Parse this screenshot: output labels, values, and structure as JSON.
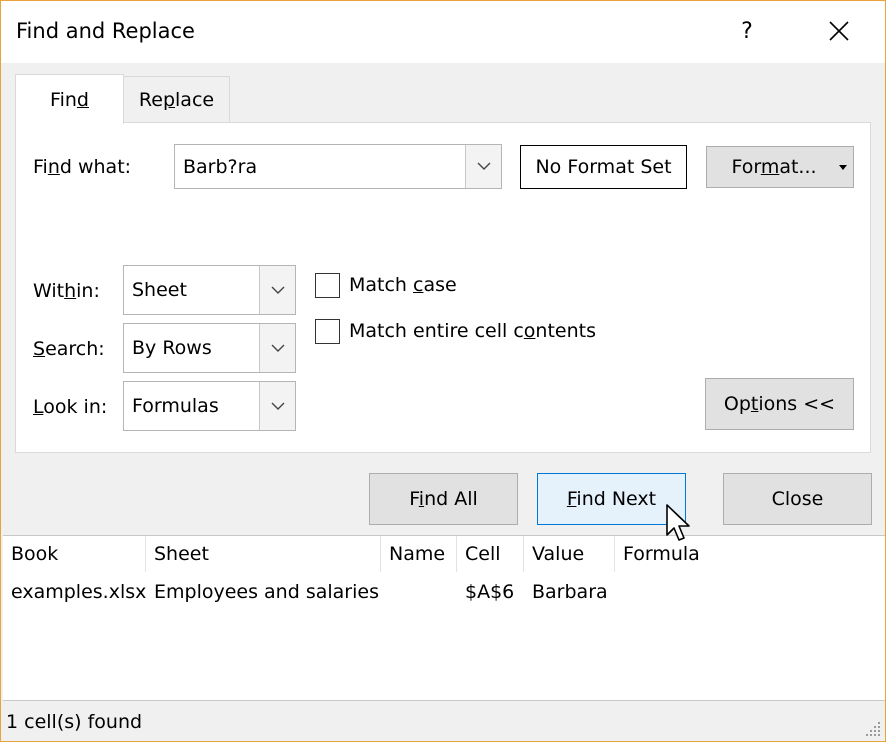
{
  "window": {
    "title": "Find and Replace",
    "help_glyph": "?",
    "close_glyph": "✕"
  },
  "tabs": [
    {
      "label": "Find",
      "mnemonic": "d",
      "active": true
    },
    {
      "label": "Replace",
      "mnemonic": "p",
      "active": false
    }
  ],
  "find_what": {
    "label": "Find what:",
    "value": "Barb?ra"
  },
  "format_preview": "No Format Set",
  "format_button": "Format...",
  "within": {
    "label": "Within:",
    "value": "Sheet"
  },
  "search": {
    "label": "Search:",
    "value": "By Rows"
  },
  "look_in": {
    "label": "Look in:",
    "value": "Formulas"
  },
  "options": {
    "match_case": {
      "label": "Match case",
      "checked": false
    },
    "match_entire": {
      "label": "Match entire cell contents",
      "checked": false
    }
  },
  "options_button": "Options <<",
  "actions": {
    "find_all": "Find All",
    "find_next": "Find Next",
    "close": "Close"
  },
  "results": {
    "columns": [
      "Book",
      "Sheet",
      "Name",
      "Cell",
      "Value",
      "Formula"
    ],
    "rows": [
      {
        "book": "examples.xlsx",
        "sheet": "Employees and salaries",
        "name": "",
        "cell": "$A$6",
        "value": "Barbara",
        "formula": ""
      }
    ]
  },
  "status": "1 cell(s) found",
  "colors": {
    "window_border": "#e8a33d",
    "default_button_border": "#0078d7",
    "default_button_fill": "#e5f1fb"
  }
}
